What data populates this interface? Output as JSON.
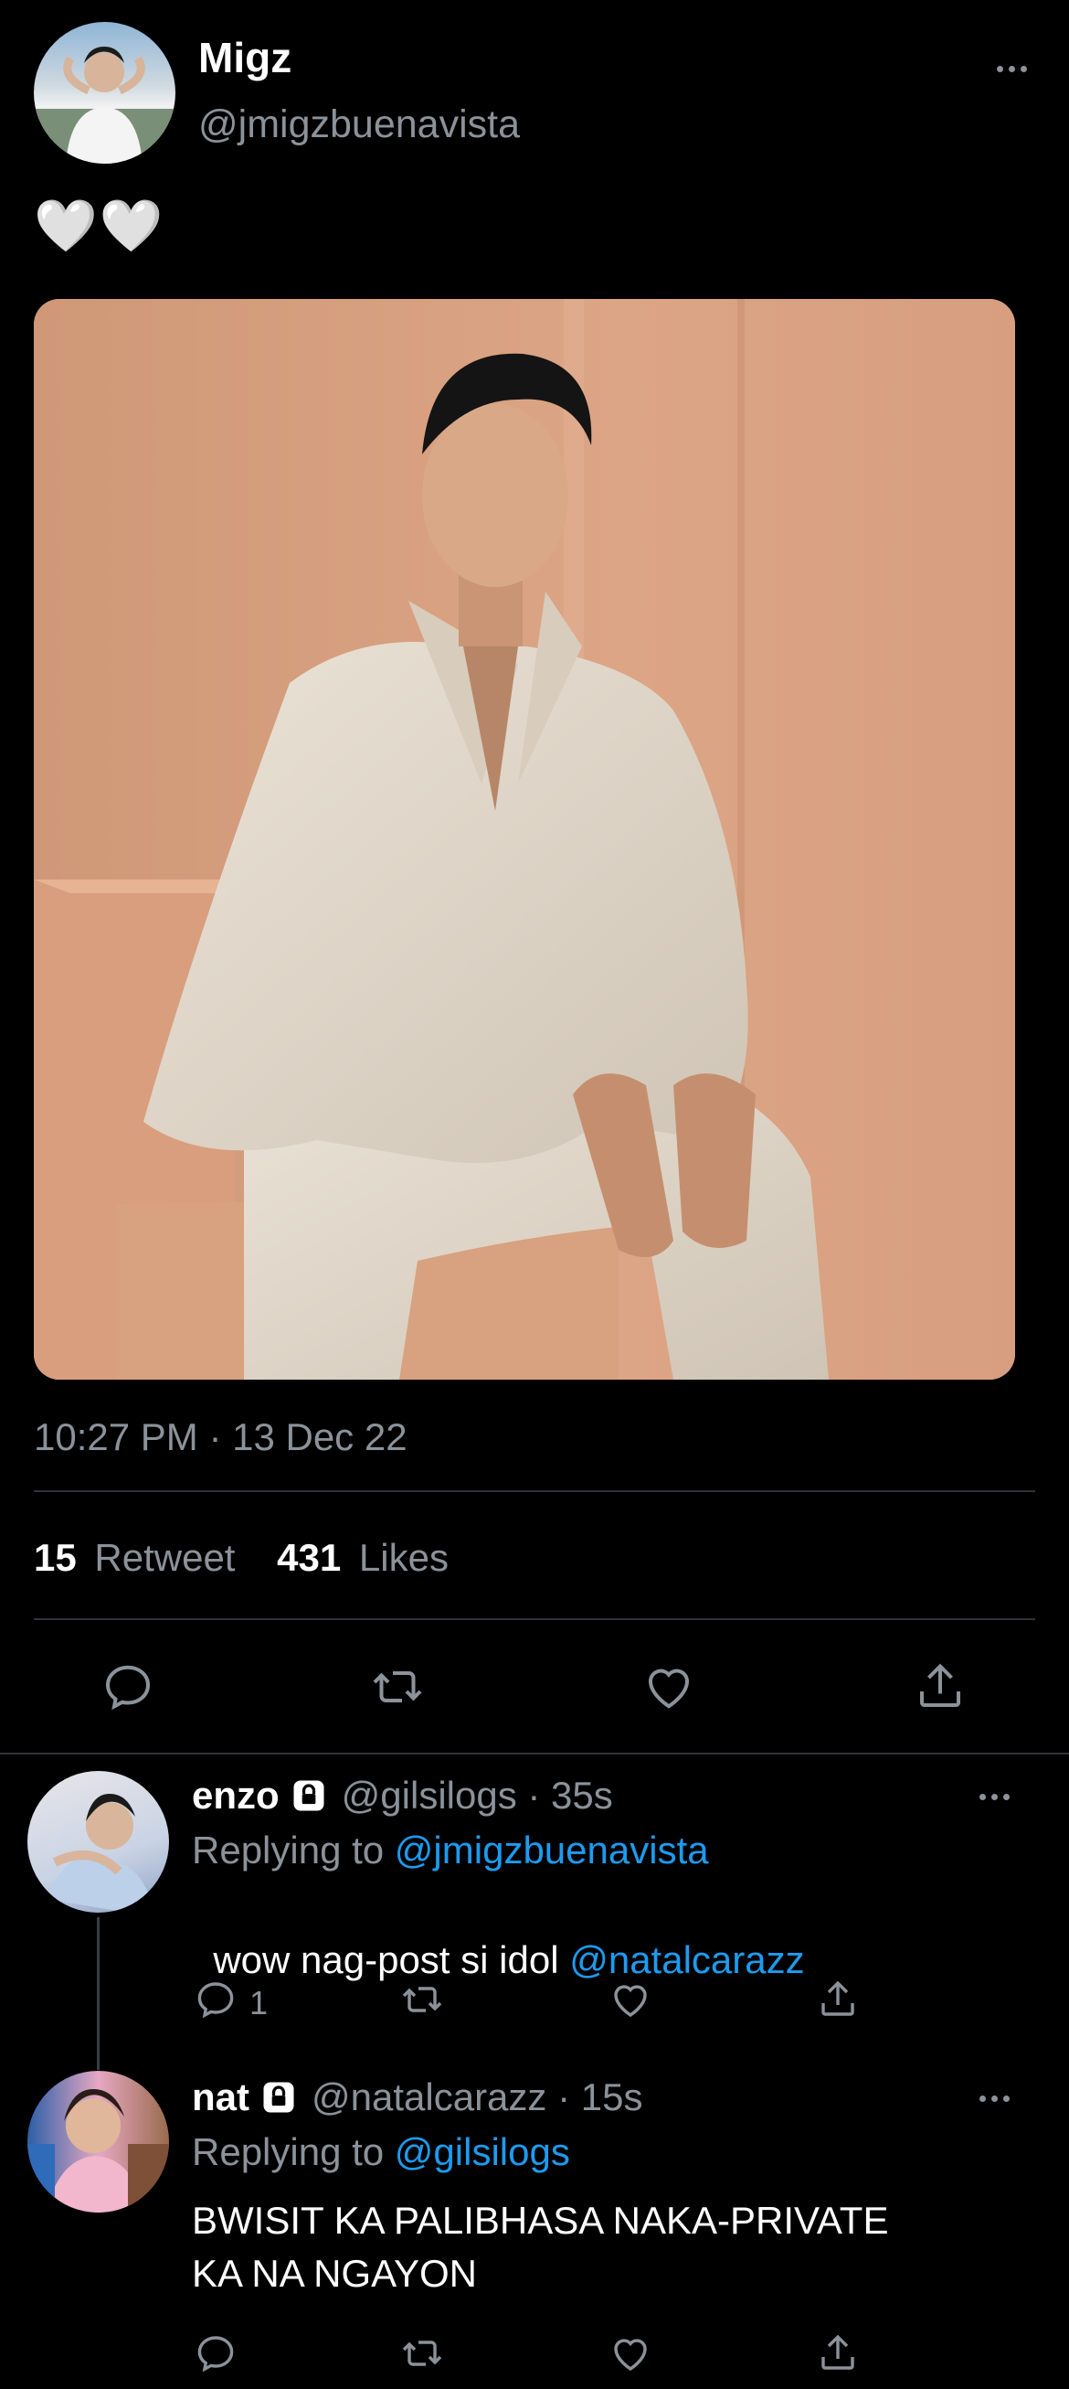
{
  "main_tweet": {
    "author_name": "Migz",
    "author_handle": "@jmigzbuenavista",
    "text": "🤍🤍",
    "image_alt": "Man in a cream suit seated on a peach block against a peach wall",
    "timestamp": "10:27 PM · 13 Dec 22",
    "stats": {
      "retweet_count": "15",
      "retweet_label": "Retweet",
      "like_count": "431",
      "like_label": "Likes"
    }
  },
  "replies": [
    {
      "name": "enzo",
      "handle_time": "@gilsilogs · 35s",
      "replying_prefix": "Replying to ",
      "replying_to": "@jmigzbuenavista",
      "text": "wow nag-post si idol ",
      "mention": "@natalcarazz",
      "reply_count": "1"
    },
    {
      "name": "nat",
      "handle_time": "@natalcarazz · 15s",
      "replying_prefix": "Replying to ",
      "replying_to": "@gilsilogs",
      "text_line1": "BWISIT KA PALIBHASA NAKA-PRIVATE",
      "text_line2": "KA NA NGAYON"
    }
  ],
  "icons": [
    "more-icon",
    "reply-icon",
    "retweet-icon",
    "like-icon",
    "share-icon",
    "lock-icon"
  ],
  "colors": {
    "background": "#000000",
    "link": "#1d9bf0",
    "muted": "#6e767d",
    "divider": "#2f3336"
  }
}
